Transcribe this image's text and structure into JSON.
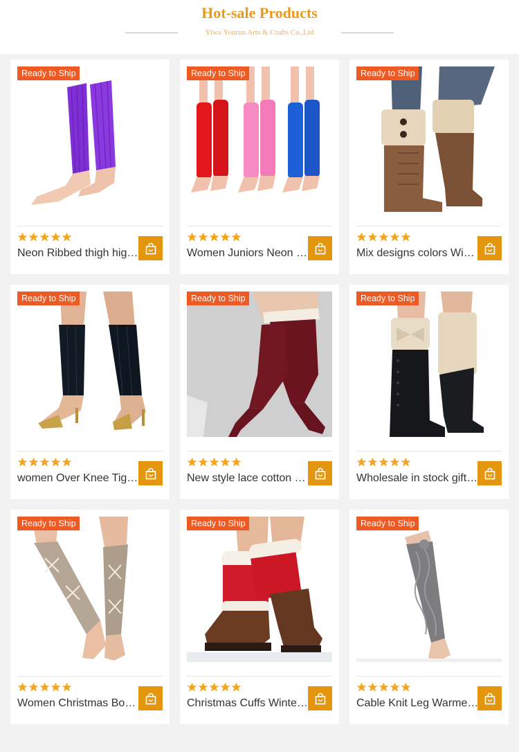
{
  "header": {
    "title": "Hot-sale Products",
    "subtitle": "Yiwu Yourun Arts & Crafts Co.,Ltd"
  },
  "colors": {
    "accent": "#e89a1c",
    "badge": "#ee5a24",
    "cart": "#e4960f",
    "star": "#f3a51c"
  },
  "products": [
    {
      "badge": "Ready to Ship",
      "title": "Neon Ribbed thigh high leg warmers",
      "rating": 5,
      "image": "purple-leg-warmers-icon"
    },
    {
      "badge": "Ready to Ship",
      "title": "Women Juniors Neon Ribbed Leg Warmers",
      "rating": 5,
      "image": "neon-leg-warmers-icon"
    },
    {
      "badge": "Ready to Ship",
      "title": "Mix designs colors Winter Knit Boot Cuffs",
      "rating": 5,
      "image": "boot-cuffs-buttons-icon"
    },
    {
      "badge": "Ready to Ship",
      "title": "women Over Knee Tights Dance Leg Warmers",
      "rating": 5,
      "image": "black-stirrup-leg-warmers-icon"
    },
    {
      "badge": "Ready to Ship",
      "title": "New style lace cotton over knee socks",
      "rating": 5,
      "image": "burgundy-lace-socks-icon"
    },
    {
      "badge": "Ready to Ship",
      "title": "Wholesale in stock gift knit boot cuffs",
      "rating": 5,
      "image": "bow-boot-cuffs-icon"
    },
    {
      "badge": "Ready to Ship",
      "title": "Women Christmas Boot Leg Warmers",
      "rating": 5,
      "image": "christmas-leg-warmers-icon"
    },
    {
      "badge": "Ready to Ship",
      "title": "Christmas Cuffs Winter Boot Toppers",
      "rating": 5,
      "image": "red-fur-boot-cuffs-icon"
    },
    {
      "badge": "Ready to Ship",
      "title": "Cable Knit Leg Warmers with Pom Pom",
      "rating": 5,
      "image": "grey-cable-leg-warmers-icon"
    }
  ]
}
